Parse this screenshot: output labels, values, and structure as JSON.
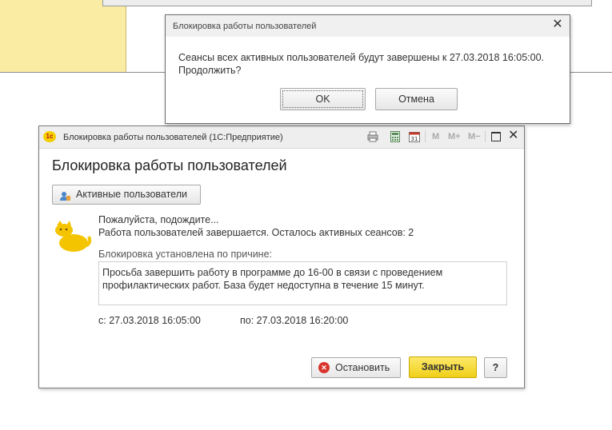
{
  "confirm_dialog": {
    "title": "Блокировка работы пользователей",
    "close_glyph": "✕",
    "message_line1": "Сеансы всех активных пользователей будут завершены к 27.03.2018 16:05:00.",
    "message_line2": "Продолжить?",
    "ok_label": "OK",
    "cancel_label": "Отмена"
  },
  "main_window": {
    "title": "Блокировка работы пользователей  (1С:Предприятие)",
    "logo_text": "1с",
    "toolbar": {
      "icons": [
        "print-icon",
        "calculator-icon",
        "calendar-icon"
      ],
      "m_label": "M",
      "m_plus_label": "M+",
      "m_minus_label": "M−",
      "close_glyph": "✕"
    },
    "heading": "Блокировка работы пользователей",
    "active_users_button": "Активные пользователи",
    "wait_text": "Пожалуйста, подождите...",
    "status_text": "Работа пользователей завершается. Осталось активных сеансов: 2",
    "reason_label": "Блокировка установлена по причине:",
    "reason_text_line1": "Просьба завершить работу в программе до 16-00 в связи с проведением",
    "reason_text_line2": "профилактических работ. База будет недоступна в течение 15 минут.",
    "from_text": "с:  27.03.2018 16:05:00",
    "to_text": "по:  27.03.2018 16:20:00",
    "stop_button": "Остановить",
    "close_button": "Закрыть",
    "help_button": "?"
  },
  "colors": {
    "accent_yellow": "#f0cf19",
    "background_yellow": "#fbeca4",
    "stop_red": "#d9342b"
  }
}
